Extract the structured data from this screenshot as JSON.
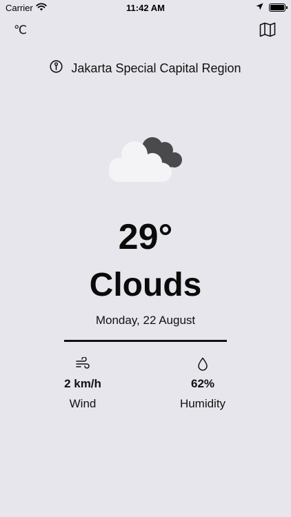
{
  "status_bar": {
    "carrier": "Carrier",
    "time": "11:42 AM"
  },
  "header": {
    "unit_label": "℃",
    "map_icon": "map-icon"
  },
  "location": {
    "name": "Jakarta Special Capital Region",
    "icon": "location-info-icon"
  },
  "weather": {
    "icon": "clouds-icon",
    "temperature": "29°",
    "condition": "Clouds",
    "date": "Monday, 22 August"
  },
  "stats": {
    "wind": {
      "value": "2 km/h",
      "label": "Wind",
      "icon": "wind-icon"
    },
    "humidity": {
      "value": "62%",
      "label": "Humidity",
      "icon": "droplet-icon"
    }
  },
  "colors": {
    "background": "#e6e6ec",
    "text": "#111111",
    "cloud_light": "#f4f4f6",
    "cloud_dark": "#4a4a4c"
  }
}
